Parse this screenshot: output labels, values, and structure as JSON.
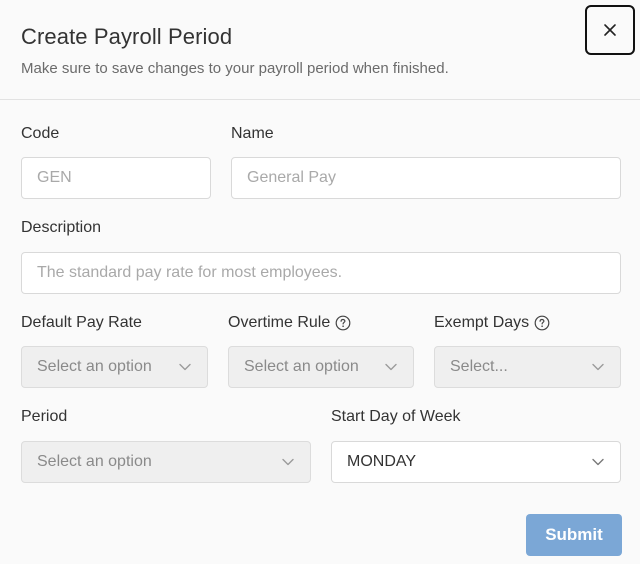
{
  "dialog": {
    "title": "Create Payroll Period",
    "subtitle": "Make sure to save changes to your payroll period when finished.",
    "close_label": "×"
  },
  "form": {
    "code": {
      "label": "Code",
      "placeholder": "GEN"
    },
    "name": {
      "label": "Name",
      "placeholder": "General Pay"
    },
    "description": {
      "label": "Description",
      "placeholder": "The standard pay rate for most employees."
    },
    "default_pay_rate": {
      "label": "Default Pay Rate",
      "value": "Select an option"
    },
    "overtime_rule": {
      "label": "Overtime Rule",
      "value": "Select an option",
      "help_icon": "question-circle-icon"
    },
    "exempt_days": {
      "label": "Exempt Days",
      "value": "Select...",
      "help_icon": "question-circle-icon"
    },
    "period": {
      "label": "Period",
      "value": "Select an option"
    },
    "start_day_of_week": {
      "label": "Start Day of Week",
      "value": "MONDAY"
    }
  },
  "actions": {
    "submit_label": "Submit"
  },
  "colors": {
    "primary_button": "#7ba7d6",
    "disabled_field": "#efefef"
  }
}
